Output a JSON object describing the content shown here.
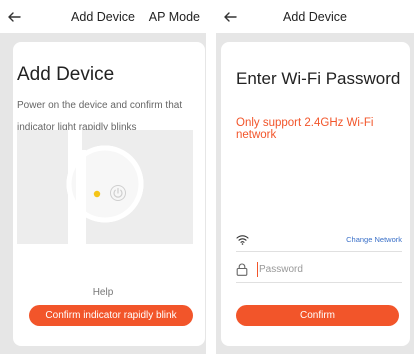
{
  "left": {
    "header": {
      "title": "Add Device",
      "ap_mode_label": "AP Mode"
    },
    "card": {
      "title": "Add Device",
      "instruction": "Power on the device and confirm that indicator light rapidly blinks",
      "help_label": "Help",
      "confirm_label": "Confirm indicator rapidly blink"
    }
  },
  "right": {
    "header": {
      "title": "Add Device"
    },
    "card": {
      "title": "Enter Wi-Fi Password",
      "warning": "Only support 2.4GHz Wi-Fi network",
      "change_network_label": "Change Network",
      "password_placeholder": "Password",
      "confirm_label": "Confirm"
    }
  },
  "colors": {
    "accent": "#f2552a",
    "link": "#3a70c8",
    "indicator": "#f5c518",
    "background": "#e6e6e6"
  },
  "icons": [
    "back-arrow-icon",
    "wifi-icon",
    "lock-icon",
    "power-icon"
  ]
}
